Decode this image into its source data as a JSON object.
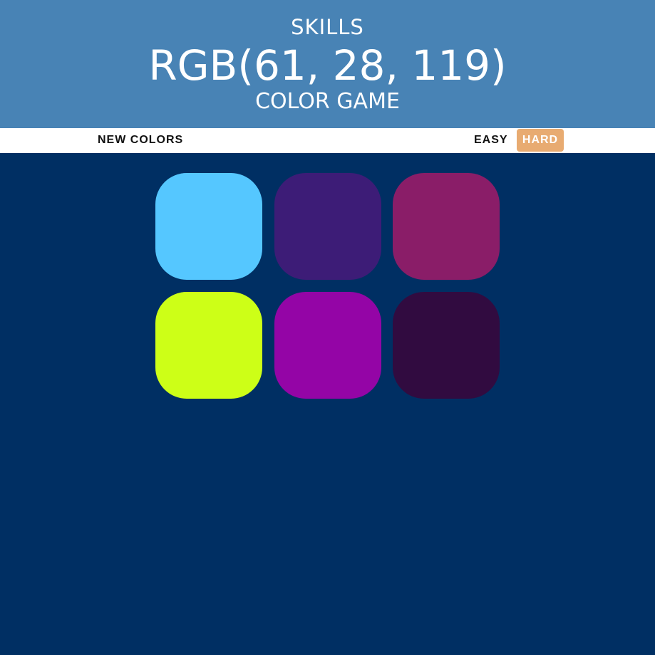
{
  "header": {
    "top_text": "SKILLS",
    "target_rgb": "RGB(61, 28, 119)",
    "subtitle": "COLOR GAME"
  },
  "stripe": {
    "new_colors_label": "NEW COLORS",
    "easy_label": "EASY",
    "hard_label": "HARD",
    "selected_mode": "HARD",
    "selected_color": "#e8ab71"
  },
  "squares": [
    {
      "color": "#55c7ff"
    },
    {
      "color": "#3d1c77"
    },
    {
      "color": "#8a1d68"
    },
    {
      "color": "#cdff17"
    },
    {
      "color": "#9405a6"
    },
    {
      "color": "#310b40"
    }
  ],
  "colors": {
    "header_bg": "#4883b5",
    "page_bg": "#002f63"
  }
}
